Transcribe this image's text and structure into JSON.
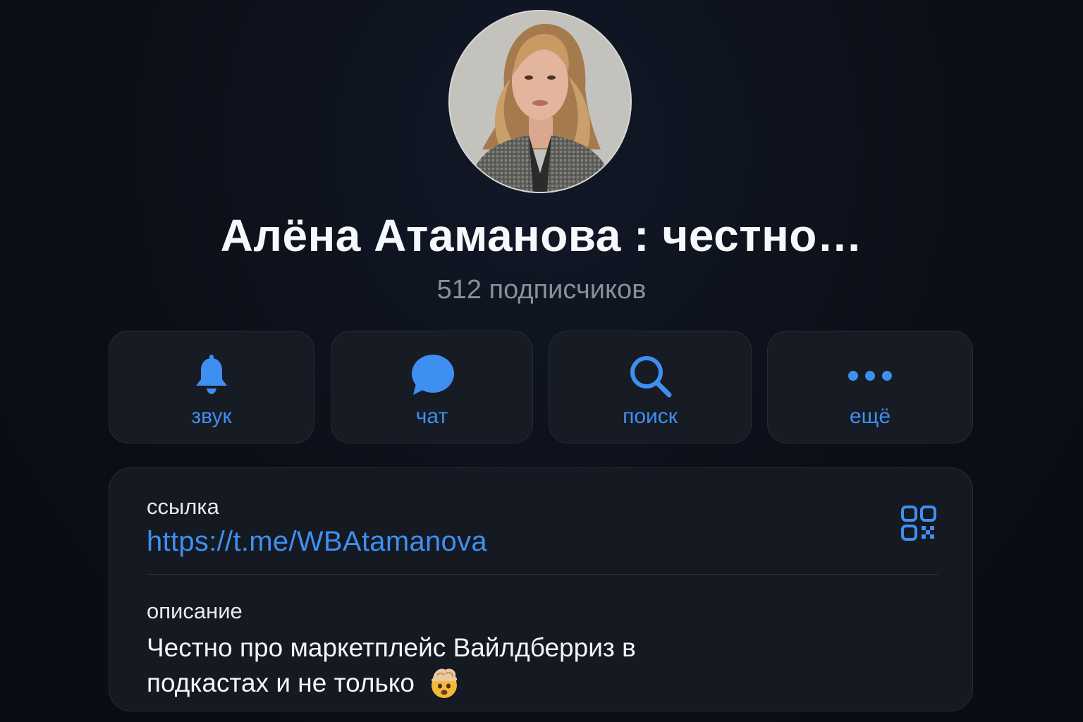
{
  "profile": {
    "name": "Алёна Атаманова : честно…",
    "subscribers": "512 подписчиков"
  },
  "actions": [
    {
      "label": "звук",
      "icon": "bell-icon"
    },
    {
      "label": "чат",
      "icon": "chat-bubble-icon"
    },
    {
      "label": "поиск",
      "icon": "search-icon"
    },
    {
      "label": "ещё",
      "icon": "more-dots-icon"
    }
  ],
  "info": {
    "link_label": "ссылка",
    "link_value": "https://t.me/WBAtamanova",
    "description_label": "описание",
    "description_line1": "Честно про маркетплейс Вайлдберриз в",
    "description_line2": "подкастах и не только",
    "description_emoji": "exploding-head-emoji",
    "qr_icon": "qr-code-icon"
  },
  "colors": {
    "accent": "#3f8ff0",
    "background": "#0b0f17",
    "card": "#161b24",
    "muted_text": "#8a8f98"
  }
}
